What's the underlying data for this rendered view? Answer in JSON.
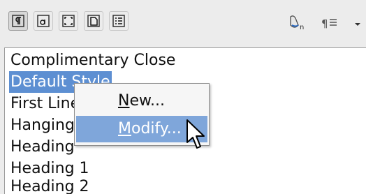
{
  "toolbar": {
    "buttons": [
      {
        "icon": "paragraph-styles-icon",
        "active": true
      },
      {
        "icon": "character-styles-icon",
        "active": false
      },
      {
        "icon": "frame-styles-icon",
        "active": false
      },
      {
        "icon": "page-styles-icon",
        "active": false
      },
      {
        "icon": "list-styles-icon",
        "active": false
      }
    ],
    "right_icons": [
      "fill-format-mode-icon",
      "new-style-from-selection-icon",
      "dropdown-arrow-icon"
    ]
  },
  "styles_list": {
    "items": [
      "Complimentary Close",
      "Default Style",
      "First Line Indent",
      "Hanging Indent",
      "Heading",
      "Heading 1",
      "Heading 2"
    ],
    "selected": "Default Style"
  },
  "context_menu": {
    "items": [
      {
        "label_mnemonic": "N",
        "label_rest": "ew..."
      },
      {
        "label_mnemonic": "M",
        "label_rest": "odify..."
      }
    ],
    "hovered": "Modify..."
  },
  "colors": {
    "selection": "#5d8fd2",
    "menu_hover": "#7fa6da"
  }
}
